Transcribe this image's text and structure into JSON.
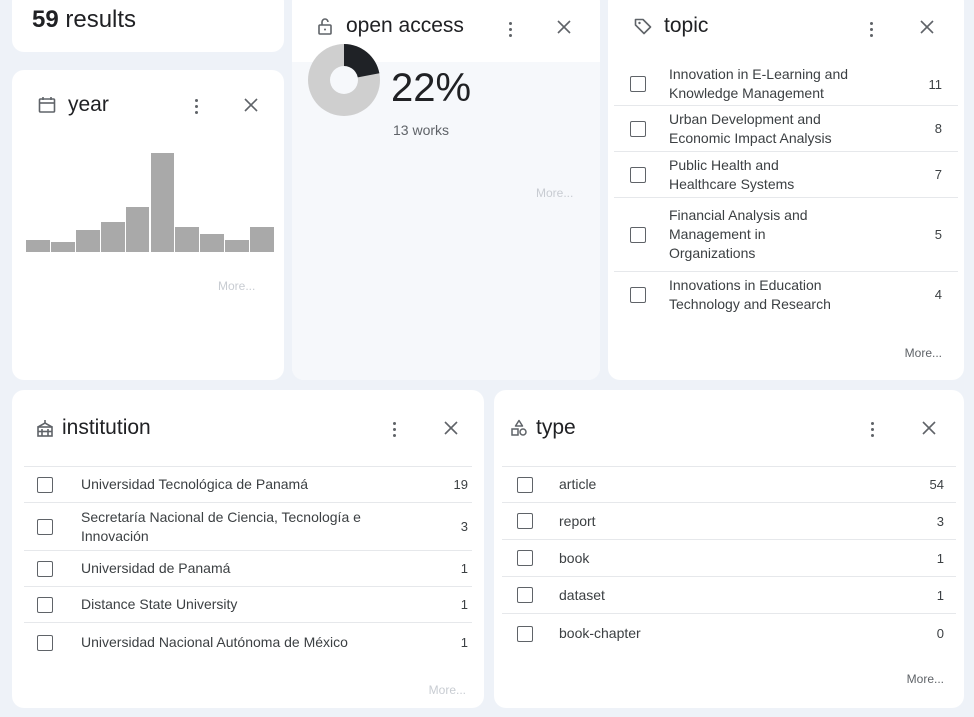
{
  "results": {
    "count": "59",
    "suffix": " results"
  },
  "colors": {
    "bar": "#a9a9a9",
    "pie_main": "#cfcfcf",
    "pie_slice": "#1f2226"
  },
  "year": {
    "title": "year",
    "icon": "calendar-icon",
    "bar_levels": [
      0.12,
      0.1,
      0.22,
      0.3,
      0.45,
      0.99,
      0.25,
      0.18,
      0.12,
      0.25
    ],
    "more": "More..."
  },
  "open_access": {
    "title": "open access",
    "icon": "lock-icon",
    "percent": "22%",
    "works": "13 works",
    "fraction": 0.22,
    "more": "More..."
  },
  "topic": {
    "title": "topic",
    "icon": "tag-icon",
    "items": [
      {
        "label": "Innovation in E-Learning and Knowledge Management",
        "count": "11"
      },
      {
        "label": "Urban Development and Economic Impact Analysis",
        "count": "8"
      },
      {
        "label": "Public Health and Healthcare Systems",
        "count": "7"
      },
      {
        "label": "Financial Analysis and Management in Organizations",
        "count": "5"
      },
      {
        "label": "Innovations in Education Technology and Research",
        "count": "4"
      }
    ],
    "more": "More..."
  },
  "institution": {
    "title": "institution",
    "icon": "building-icon",
    "items": [
      {
        "label": "Universidad Tecnológica de Panamá",
        "count": "19"
      },
      {
        "label": "Secretaría Nacional de Ciencia, Tecnología e Innovación",
        "count": "3"
      },
      {
        "label": "Universidad de Panamá",
        "count": "1"
      },
      {
        "label": "Distance State University",
        "count": "1"
      },
      {
        "label": "Universidad Nacional Autónoma de México",
        "count": "1"
      }
    ],
    "more": "More..."
  },
  "type": {
    "title": "type",
    "icon": "shapes-icon",
    "items": [
      {
        "label": "article",
        "count": "54"
      },
      {
        "label": "report",
        "count": "3"
      },
      {
        "label": "book",
        "count": "1"
      },
      {
        "label": "dataset",
        "count": "1"
      },
      {
        "label": "book-chapter",
        "count": "0"
      }
    ],
    "more": "More..."
  }
}
